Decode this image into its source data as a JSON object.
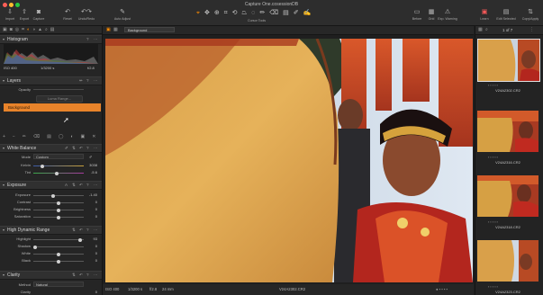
{
  "window": {
    "title": "Capture One.cosessionDB"
  },
  "toolbar": {
    "left_buttons": [
      {
        "label": "Import",
        "icon": "import-icon",
        "glyph": "⇩"
      },
      {
        "label": "Export",
        "icon": "export-icon",
        "glyph": "⇧"
      },
      {
        "label": "Capture",
        "icon": "camera-icon",
        "glyph": "◙"
      },
      {
        "label": "Reset",
        "icon": "reset-icon",
        "glyph": "↶"
      },
      {
        "label": "Undo/Redo",
        "icon": "undo-redo-icon",
        "glyph": "↶↷"
      },
      {
        "label": "Auto Adjust",
        "icon": "auto-adjust-icon",
        "glyph": "✎"
      }
    ],
    "cursor_tools_label": "Cursor Tools",
    "right_buttons": [
      {
        "label": "Before",
        "icon": "before-icon",
        "glyph": "▭"
      },
      {
        "label": "Grid",
        "icon": "grid-icon",
        "glyph": "▦"
      },
      {
        "label": "Exp. Warning",
        "icon": "exposure-warning-icon",
        "glyph": "⚠"
      },
      {
        "label": "Learn",
        "icon": "learn-icon",
        "glyph": "▣"
      },
      {
        "label": "Edit Selected",
        "icon": "edit-selected-icon",
        "glyph": "▤"
      },
      {
        "label": "Copy/Apply",
        "icon": "copy-apply-icon",
        "glyph": "⇅"
      }
    ]
  },
  "viewer": {
    "variant_name": "Background"
  },
  "browser": {
    "count": "1 of 7"
  },
  "histogram": {
    "title": "Histogram",
    "iso": "ISO 400",
    "shutter": "1/3200 s",
    "aperture": "f/2.8"
  },
  "layers": {
    "title": "Layers",
    "opacity_label": "Opacity",
    "luma_range_label": "Luma Range...",
    "layer_name": "Background"
  },
  "white_balance": {
    "title": "White Balance",
    "mode_label": "Mode",
    "mode_value": "Custom",
    "kelvin_label": "Kelvin",
    "kelvin_value": "3038",
    "tint_label": "Tint",
    "tint_value": "-5.6"
  },
  "exposure": {
    "title": "Exposure",
    "rows": [
      {
        "label": "Exposure",
        "value": "-1.40"
      },
      {
        "label": "Contrast",
        "value": "0"
      },
      {
        "label": "Brightness",
        "value": "0"
      },
      {
        "label": "Saturation",
        "value": "0"
      }
    ]
  },
  "hdr": {
    "title": "High Dynamic Range",
    "rows": [
      {
        "label": "Highlight",
        "value": "93"
      },
      {
        "label": "Shadow",
        "value": "0"
      },
      {
        "label": "White",
        "value": "0"
      },
      {
        "label": "Black",
        "value": "0"
      }
    ]
  },
  "clarity": {
    "title": "Clarity",
    "method_label": "Method",
    "method_value": "Natural",
    "clarity_label": "Clarity",
    "clarity_value": "0"
  },
  "status": {
    "iso": "ISO 400",
    "shutter": "1/3200 s",
    "aperture": "f/2.8",
    "focal": "24 mm",
    "filename": "V24A2302.CR2"
  },
  "thumbnails": [
    {
      "filename": "V24A2302.CR2"
    },
    {
      "filename": "V24A2316.CR2"
    },
    {
      "filename": "V24A2318.CR2"
    },
    {
      "filename": "V24A2323.CR2"
    }
  ],
  "colors": {
    "accent": "#ff8c00",
    "selected_layer": "#e8832a"
  }
}
